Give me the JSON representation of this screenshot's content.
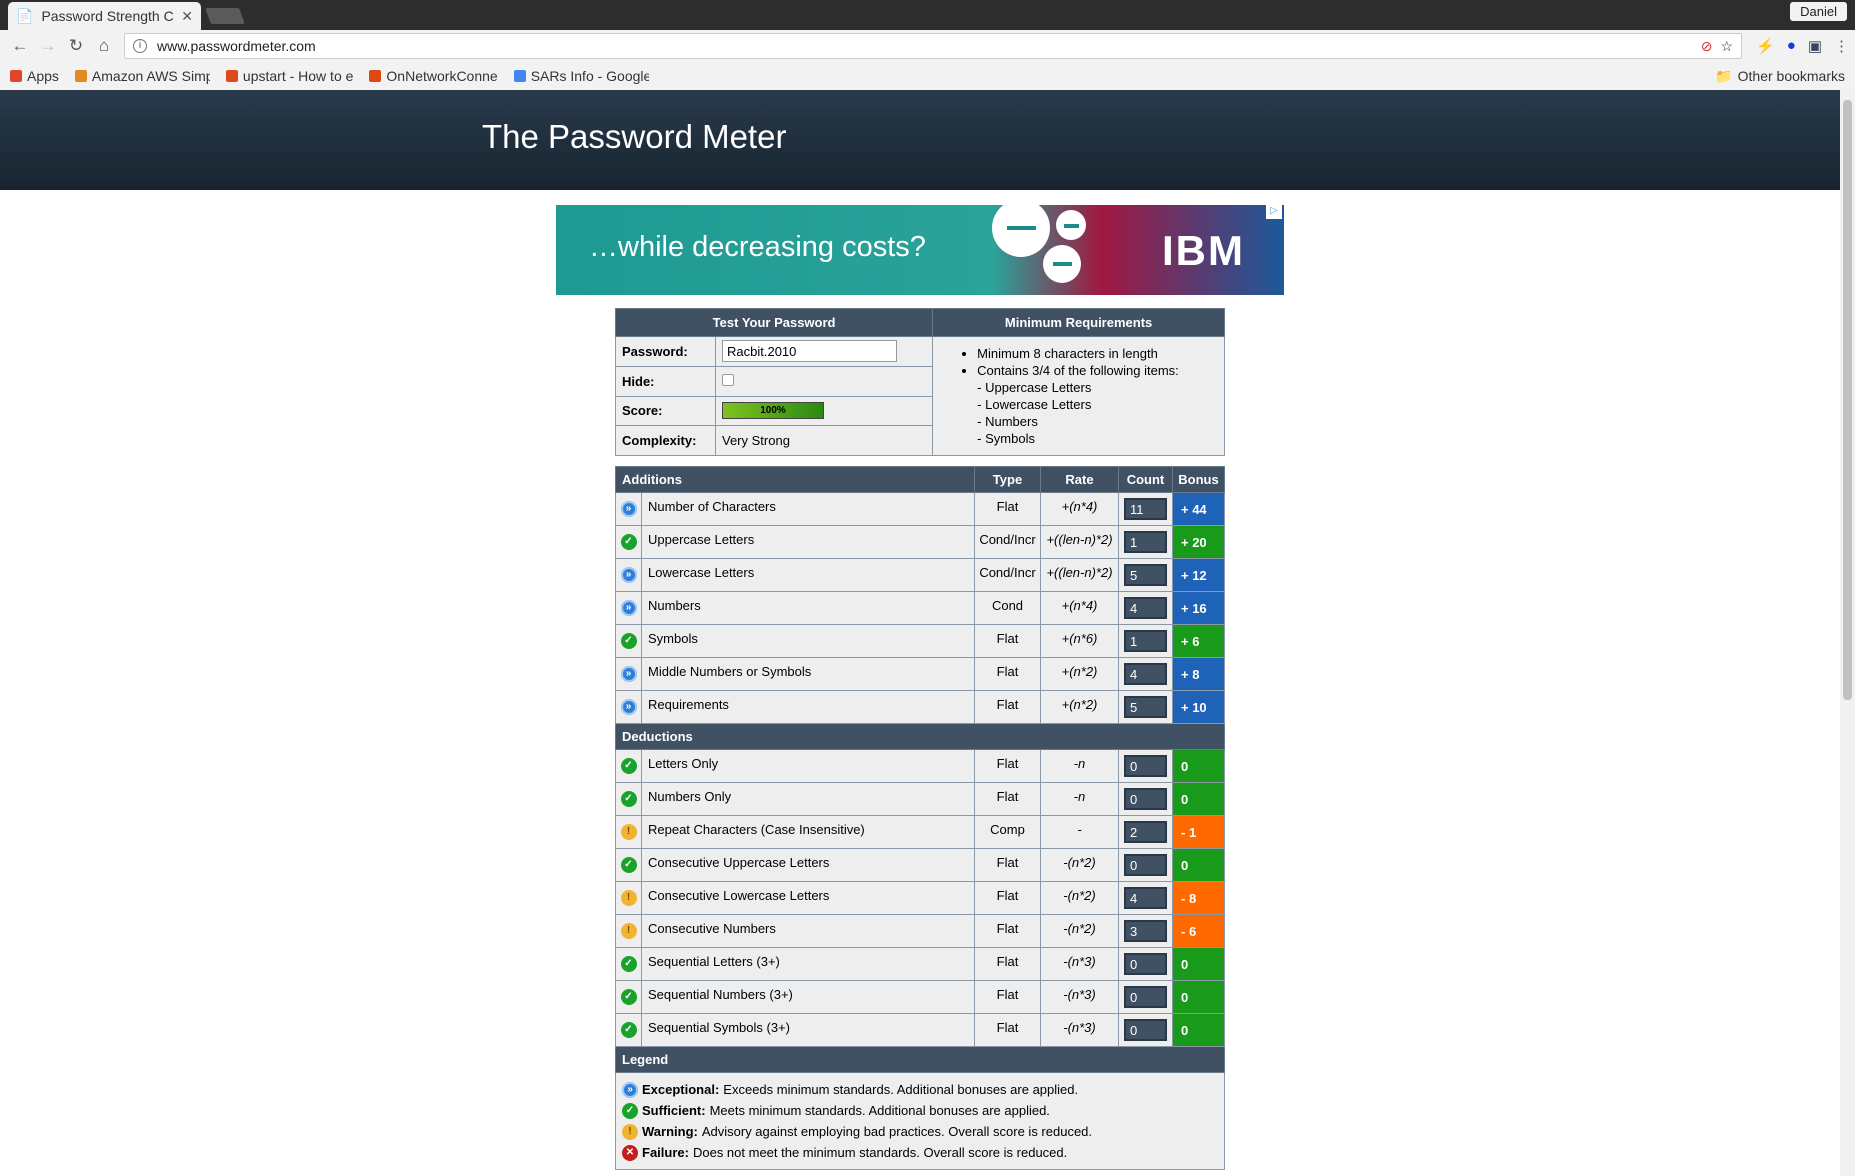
{
  "browser": {
    "tab_title": "Password Strength C",
    "user": "Daniel",
    "url": "www.passwordmeter.com",
    "bookmarks": [
      {
        "label": "Apps",
        "icon": "apps-grid-icon",
        "color": "#e0452b"
      },
      {
        "label": "Amazon AWS Simp",
        "icon": "amazon-icon",
        "color": "#e58a1f"
      },
      {
        "label": "upstart - How to e",
        "icon": "askubuntu-icon",
        "color": "#dc4a1c"
      },
      {
        "label": "OnNetworkConne",
        "icon": "ubuntu-icon",
        "color": "#dd4814"
      },
      {
        "label": "SARs Info - Google",
        "icon": "google-docs-icon",
        "color": "#4285f4"
      }
    ],
    "other_bookmarks": "Other bookmarks"
  },
  "site": {
    "title": "The Password Meter",
    "ad_text": "…while decreasing costs?",
    "ad_brand": "IBM"
  },
  "test": {
    "header": "Test Your Password",
    "password_label": "Password:",
    "password_value": "Racbit.2010",
    "hide_label": "Hide:",
    "score_label": "Score:",
    "score_value": "100%",
    "score_fraction": 1.0,
    "complexity_label": "Complexity:",
    "complexity_value": "Very Strong"
  },
  "requirements": {
    "header": "Minimum Requirements",
    "items": [
      "Minimum 8 characters in length",
      "Contains 3/4 of the following items:"
    ],
    "sub_items": [
      "- Uppercase Letters",
      "- Lowercase Letters",
      "- Numbers",
      "- Symbols"
    ]
  },
  "columns": {
    "additions": "Additions",
    "type": "Type",
    "rate": "Rate",
    "count": "Count",
    "bonus": "Bonus"
  },
  "additions": [
    {
      "status": "exc",
      "name": "Number of Characters",
      "type": "Flat",
      "rate": "+(n*4)",
      "count": "11",
      "bonus": "+ 44",
      "color": "blue"
    },
    {
      "status": "suf",
      "name": "Uppercase Letters",
      "type": "Cond/Incr",
      "rate": "+((len-n)*2)",
      "count": "1",
      "bonus": "+ 20",
      "color": "green"
    },
    {
      "status": "exc",
      "name": "Lowercase Letters",
      "type": "Cond/Incr",
      "rate": "+((len-n)*2)",
      "count": "5",
      "bonus": "+ 12",
      "color": "blue"
    },
    {
      "status": "exc",
      "name": "Numbers",
      "type": "Cond",
      "rate": "+(n*4)",
      "count": "4",
      "bonus": "+ 16",
      "color": "blue"
    },
    {
      "status": "suf",
      "name": "Symbols",
      "type": "Flat",
      "rate": "+(n*6)",
      "count": "1",
      "bonus": "+ 6",
      "color": "green"
    },
    {
      "status": "exc",
      "name": "Middle Numbers or Symbols",
      "type": "Flat",
      "rate": "+(n*2)",
      "count": "4",
      "bonus": "+ 8",
      "color": "blue"
    },
    {
      "status": "exc",
      "name": "Requirements",
      "type": "Flat",
      "rate": "+(n*2)",
      "count": "5",
      "bonus": "+ 10",
      "color": "blue"
    }
  ],
  "deductions_label": "Deductions",
  "deductions": [
    {
      "status": "suf",
      "name": "Letters Only",
      "type": "Flat",
      "rate": "-n",
      "count": "0",
      "bonus": "0",
      "color": "green"
    },
    {
      "status": "suf",
      "name": "Numbers Only",
      "type": "Flat",
      "rate": "-n",
      "count": "0",
      "bonus": "0",
      "color": "green"
    },
    {
      "status": "war",
      "name": "Repeat Characters (Case Insensitive)",
      "type": "Comp",
      "rate": "-",
      "count": "2",
      "bonus": "- 1",
      "color": "orange"
    },
    {
      "status": "suf",
      "name": "Consecutive Uppercase Letters",
      "type": "Flat",
      "rate": "-(n*2)",
      "count": "0",
      "bonus": "0",
      "color": "green"
    },
    {
      "status": "war",
      "name": "Consecutive Lowercase Letters",
      "type": "Flat",
      "rate": "-(n*2)",
      "count": "4",
      "bonus": "- 8",
      "color": "orange"
    },
    {
      "status": "war",
      "name": "Consecutive Numbers",
      "type": "Flat",
      "rate": "-(n*2)",
      "count": "3",
      "bonus": "- 6",
      "color": "orange"
    },
    {
      "status": "suf",
      "name": "Sequential Letters (3+)",
      "type": "Flat",
      "rate": "-(n*3)",
      "count": "0",
      "bonus": "0",
      "color": "green"
    },
    {
      "status": "suf",
      "name": "Sequential Numbers (3+)",
      "type": "Flat",
      "rate": "-(n*3)",
      "count": "0",
      "bonus": "0",
      "color": "green"
    },
    {
      "status": "suf",
      "name": "Sequential Symbols (3+)",
      "type": "Flat",
      "rate": "-(n*3)",
      "count": "0",
      "bonus": "0",
      "color": "green"
    }
  ],
  "legend": {
    "title": "Legend",
    "items": [
      {
        "status": "exc",
        "term": "Exceptional:",
        "desc": "Exceeds minimum standards. Additional bonuses are applied."
      },
      {
        "status": "suf",
        "term": "Sufficient:",
        "desc": "Meets minimum standards. Additional bonuses are applied."
      },
      {
        "status": "war",
        "term": "Warning:",
        "desc": "Advisory against employing bad practices. Overall score is reduced."
      },
      {
        "status": "fai",
        "term": "Failure:",
        "desc": "Does not meet the minimum standards. Overall score is reduced."
      }
    ]
  },
  "status_icons": {
    "exc": "exceptional-icon",
    "suf": "sufficient-check-icon",
    "war": "warning-icon",
    "fai": "failure-x-icon"
  }
}
